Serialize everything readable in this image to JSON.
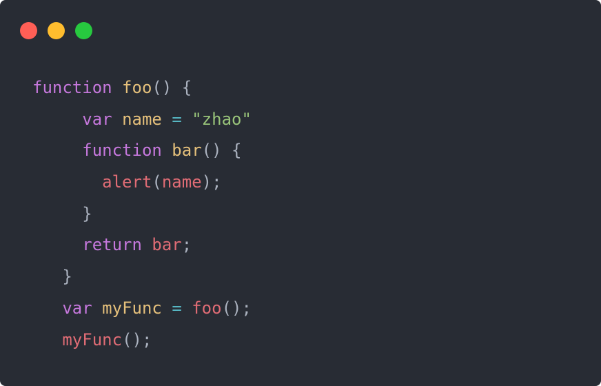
{
  "window": {
    "controls": {
      "close_color": "#ff5f56",
      "minimize_color": "#ffbd2e",
      "maximize_color": "#27c93f"
    }
  },
  "code": {
    "lines": [
      {
        "indent": "",
        "tokens": [
          {
            "text": "function",
            "kind": "kw"
          },
          {
            "text": " ",
            "kind": "punc"
          },
          {
            "text": "foo",
            "kind": "fn"
          },
          {
            "text": "() {",
            "kind": "punc"
          }
        ]
      },
      {
        "indent": "     ",
        "tokens": [
          {
            "text": "var",
            "kind": "kw"
          },
          {
            "text": " ",
            "kind": "punc"
          },
          {
            "text": "name",
            "kind": "var"
          },
          {
            "text": " ",
            "kind": "punc"
          },
          {
            "text": "=",
            "kind": "op"
          },
          {
            "text": " ",
            "kind": "punc"
          },
          {
            "text": "\"zhao\"",
            "kind": "str"
          }
        ]
      },
      {
        "indent": "     ",
        "tokens": [
          {
            "text": "function",
            "kind": "kw"
          },
          {
            "text": " ",
            "kind": "punc"
          },
          {
            "text": "bar",
            "kind": "fn"
          },
          {
            "text": "() {",
            "kind": "punc"
          }
        ]
      },
      {
        "indent": "       ",
        "tokens": [
          {
            "text": "alert",
            "kind": "call"
          },
          {
            "text": "(",
            "kind": "punc"
          },
          {
            "text": "name",
            "kind": "call"
          },
          {
            "text": ");",
            "kind": "punc"
          }
        ]
      },
      {
        "indent": "     ",
        "tokens": [
          {
            "text": "}",
            "kind": "punc"
          }
        ]
      },
      {
        "indent": "     ",
        "tokens": [
          {
            "text": "return",
            "kind": "kw"
          },
          {
            "text": " ",
            "kind": "punc"
          },
          {
            "text": "bar",
            "kind": "call"
          },
          {
            "text": ";",
            "kind": "punc"
          }
        ]
      },
      {
        "indent": "   ",
        "tokens": [
          {
            "text": "}",
            "kind": "punc"
          }
        ]
      },
      {
        "indent": "   ",
        "tokens": [
          {
            "text": "var",
            "kind": "kw"
          },
          {
            "text": " ",
            "kind": "punc"
          },
          {
            "text": "myFunc",
            "kind": "var"
          },
          {
            "text": " ",
            "kind": "punc"
          },
          {
            "text": "=",
            "kind": "op"
          },
          {
            "text": " ",
            "kind": "punc"
          },
          {
            "text": "foo",
            "kind": "call"
          },
          {
            "text": "();",
            "kind": "punc"
          }
        ]
      },
      {
        "indent": "   ",
        "tokens": [
          {
            "text": "myFunc",
            "kind": "call"
          },
          {
            "text": "();",
            "kind": "punc"
          }
        ]
      }
    ]
  }
}
